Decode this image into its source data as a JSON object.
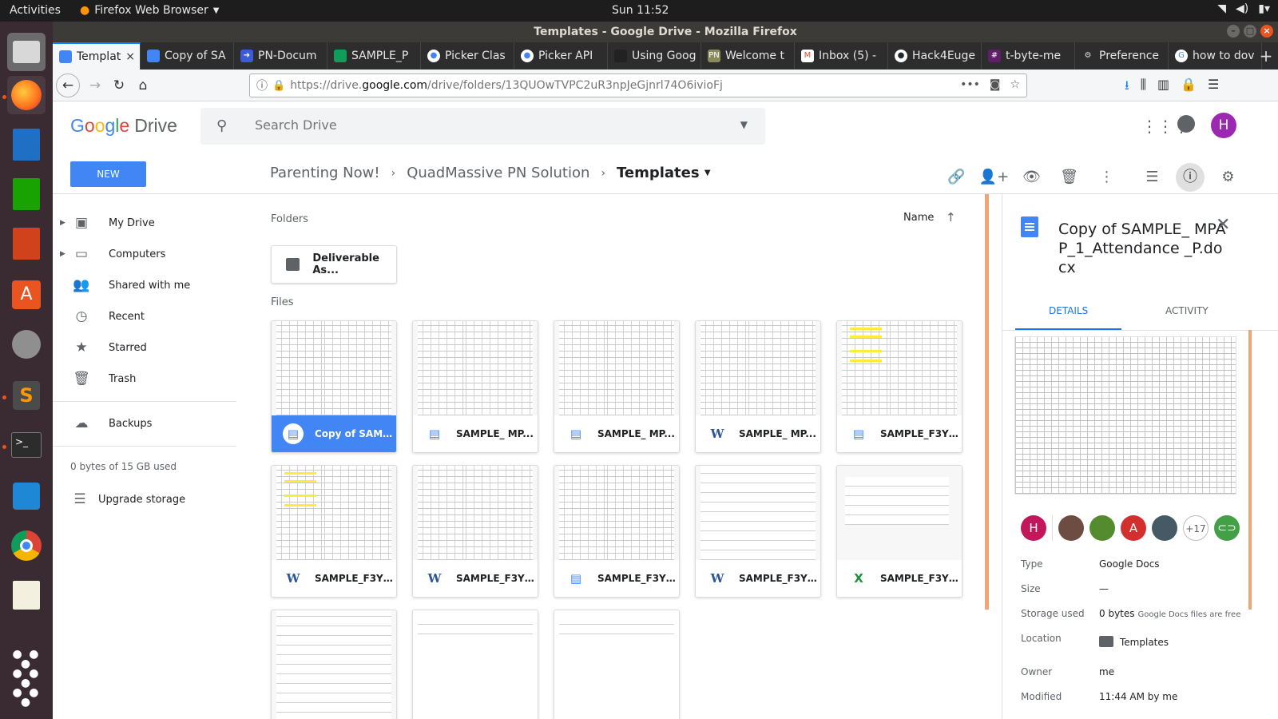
{
  "topbar": {
    "activities": "Activities",
    "app_name": "Firefox Web Browser",
    "clock": "Sun 11:52"
  },
  "window": {
    "title": "Templates - Google Drive - Mozilla Firefox"
  },
  "tabs": [
    {
      "label": "Templat",
      "color": "#4285f4"
    },
    {
      "label": "Copy of SA",
      "color": "#4285f4"
    },
    {
      "label": "PN-Docum",
      "color": "#3b5bdb"
    },
    {
      "label": "SAMPLE_P",
      "color": "#0f9d58"
    },
    {
      "label": "Picker Clas",
      "color": "#4285f4"
    },
    {
      "label": "Picker API",
      "color": "#4285f4"
    },
    {
      "label": "Using Goog",
      "color": "#222222"
    },
    {
      "label": "Welcome t",
      "color": "#8a8a5c"
    },
    {
      "label": "Inbox (5) -",
      "color": "#ea4335"
    },
    {
      "label": "Hack4Euge",
      "color": "#24292e"
    },
    {
      "label": "t-byte-me",
      "color": "#611f69"
    },
    {
      "label": "Preference",
      "color": "#555555"
    },
    {
      "label": "how to dov",
      "color": "#4285f4"
    }
  ],
  "navbar": {
    "url_prefix": "https://drive.",
    "url_domain": "google.com",
    "url_path": "/drive/folders/13QUOwTVPC2uR3npJeGjnrl74O6ivioFj"
  },
  "drive": {
    "logo_google": [
      "G",
      "o",
      "o",
      "g",
      "l",
      "e"
    ],
    "logo_drive": "Drive",
    "search_placeholder": "Search Drive",
    "new_button": "NEW",
    "breadcrumb": [
      "Parenting Now!",
      "QuadMassive PN Solution",
      "Templates"
    ]
  },
  "sidebar": {
    "items": [
      {
        "label": "My Drive",
        "icon": "my-drive-icon"
      },
      {
        "label": "Computers",
        "icon": "computers-icon"
      },
      {
        "label": "Shared with me",
        "icon": "shared-icon"
      },
      {
        "label": "Recent",
        "icon": "clock-icon"
      },
      {
        "label": "Starred",
        "icon": "star-icon"
      },
      {
        "label": "Trash",
        "icon": "trash-icon"
      },
      {
        "label": "Backups",
        "icon": "cloud-icon"
      }
    ],
    "storage": "0 bytes of 15 GB used",
    "upgrade": "Upgrade storage"
  },
  "main": {
    "folders_label": "Folders",
    "files_label": "Files",
    "sort_label": "Name",
    "folders": [
      {
        "name": "Deliverable As..."
      }
    ],
    "files": [
      {
        "name": "Copy of SAMP...",
        "type": "doc",
        "selected": true
      },
      {
        "name": "SAMPLE_ MP...",
        "type": "doc",
        "selected": false
      },
      {
        "name": "SAMPLE_ MP...",
        "type": "doc",
        "selected": false
      },
      {
        "name": "SAMPLE_ MP...",
        "type": "word",
        "selected": false
      },
      {
        "name": "SAMPLE_F3Y_...",
        "type": "doc",
        "selected": false
      },
      {
        "name": "SAMPLE_F3Y_...",
        "type": "word",
        "selected": false
      },
      {
        "name": "SAMPLE_F3Y_...",
        "type": "word",
        "selected": false
      },
      {
        "name": "SAMPLE_F3Y_...",
        "type": "doc",
        "selected": false
      },
      {
        "name": "SAMPLE_F3Y_...",
        "type": "word",
        "selected": false
      },
      {
        "name": "SAMPLE_F3Y_...",
        "type": "xls",
        "selected": false
      },
      {
        "name": "",
        "type": "doc",
        "selected": false
      },
      {
        "name": "",
        "type": "doc",
        "selected": false
      },
      {
        "name": "",
        "type": "doc",
        "selected": false
      }
    ]
  },
  "details": {
    "title": "Copy of SAMPLE_ MPAP_1_Attendance _P.docx",
    "tab_details": "DETAILS",
    "tab_activity": "ACTIVITY",
    "sharers": [
      {
        "letter": "H",
        "color": "#c2185b"
      },
      {
        "letter": "",
        "color": "#6d4c41"
      },
      {
        "letter": "",
        "color": "#558b2f"
      },
      {
        "letter": "A",
        "color": "#d32f2f"
      },
      {
        "letter": "",
        "color": "#455a64"
      }
    ],
    "more_count": "+17",
    "props": [
      {
        "label": "Type",
        "value": "Google Docs",
        "note": ""
      },
      {
        "label": "Size",
        "value": "—",
        "note": ""
      },
      {
        "label": "Storage used",
        "value": "0 bytes",
        "note": "Google Docs files are free"
      },
      {
        "label": "Location",
        "value": "Templates",
        "note": ""
      },
      {
        "label": "Owner",
        "value": "me",
        "note": ""
      },
      {
        "label": "Modified",
        "value": "11:44 AM by me",
        "note": ""
      }
    ]
  },
  "colors": {
    "accent": "#4285f4",
    "ubuntu_orange": "#e95420"
  }
}
